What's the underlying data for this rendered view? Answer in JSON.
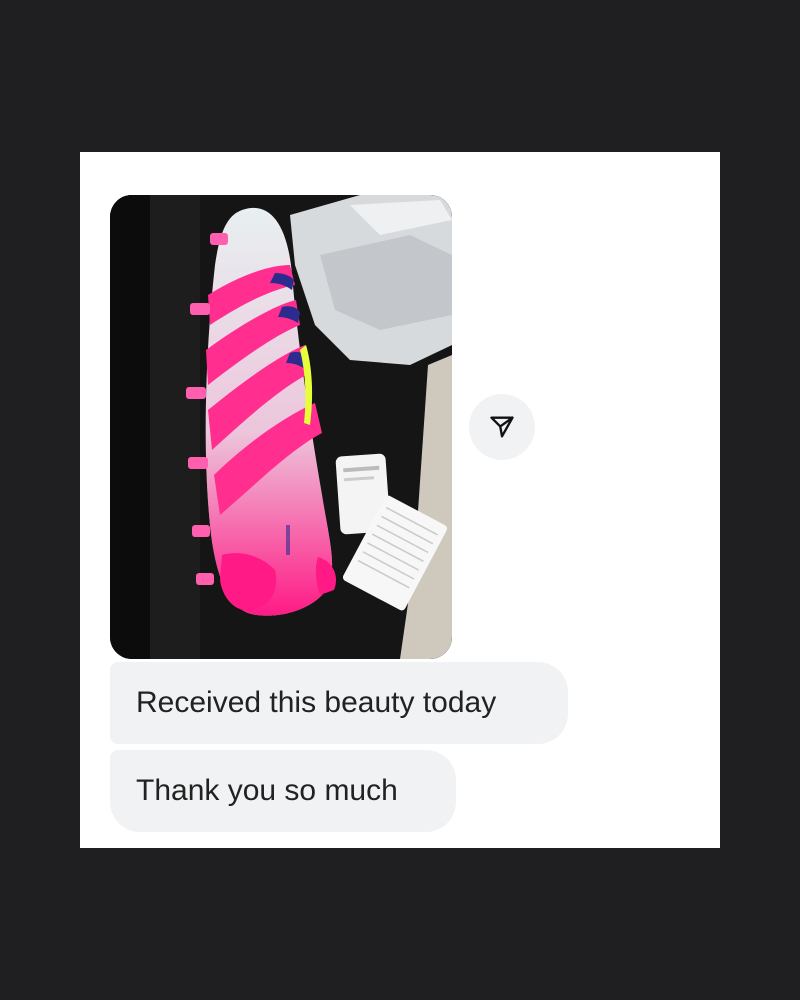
{
  "conversation": {
    "photo_message": {
      "icon": "photo-attachment",
      "description_colors": {
        "boot_main": "#e9f1f2",
        "boot_accent": "#ff1a85",
        "stripe_navy": "#2c2c8f",
        "highlight_yellow": "#e6ff3a"
      }
    },
    "share_button": {
      "icon": "send-icon"
    },
    "messages": [
      {
        "text": "Received this beauty today"
      },
      {
        "text": "Thank you so much"
      }
    ]
  }
}
